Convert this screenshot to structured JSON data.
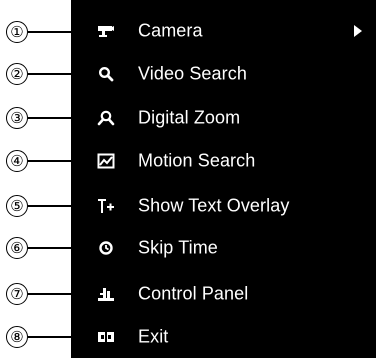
{
  "menu": {
    "items": [
      {
        "label": "Camera",
        "icon": "camera-icon",
        "callout": "①"
      },
      {
        "label": "Video Search",
        "icon": "search-icon",
        "callout": "②"
      },
      {
        "label": "Digital Zoom",
        "icon": "zoom-icon",
        "callout": "③"
      },
      {
        "label": "Motion Search",
        "icon": "motion-search-icon",
        "callout": "④"
      },
      {
        "label": "Show Text Overlay",
        "icon": "text-overlay-icon",
        "callout": "⑤"
      },
      {
        "label": "Skip Time",
        "icon": "clock-icon",
        "callout": "⑥"
      },
      {
        "label": "Control Panel",
        "icon": "control-panel-icon",
        "callout": "⑦"
      },
      {
        "label": "Exit",
        "icon": "exit-icon",
        "callout": "⑧"
      }
    ]
  },
  "colors": {
    "menu_bg": "#000000",
    "menu_text": "#ffffff",
    "callout": "#000000"
  }
}
